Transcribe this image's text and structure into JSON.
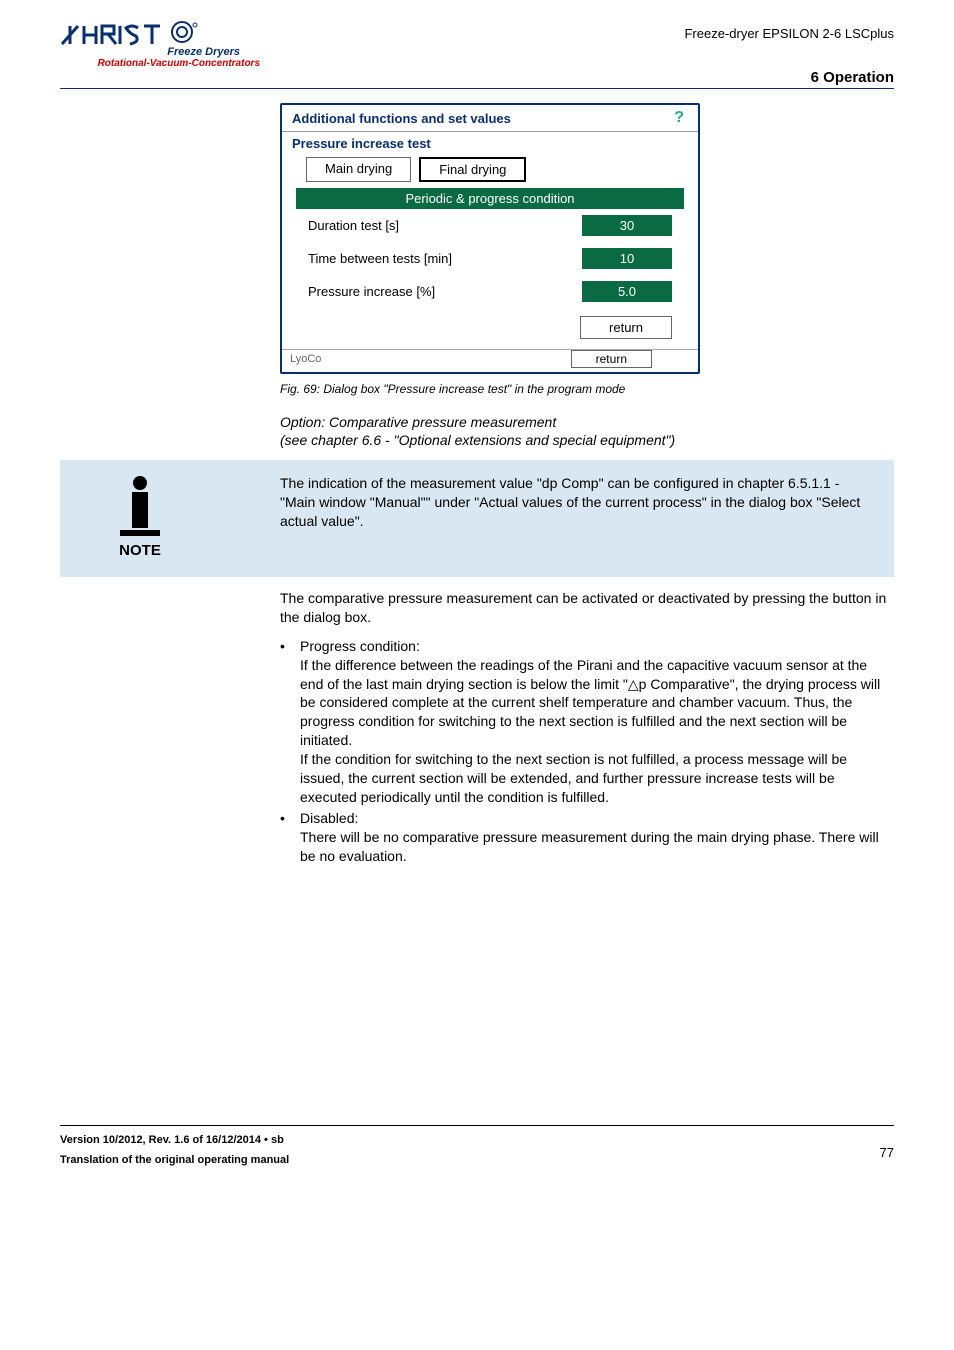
{
  "header": {
    "product": "Freeze-dryer EPSILON 2-6 LSCplus",
    "section": "6 Operation",
    "logo": {
      "tag1": "Freeze Dryers",
      "tag2": "Rotational-Vacuum-Concentrators"
    }
  },
  "dialog": {
    "title": "Additional functions and set values",
    "help": "?",
    "subtitle": "Pressure increase test",
    "tabs": {
      "main": "Main drying",
      "final": "Final drying"
    },
    "band": "Periodic & progress condition",
    "rows": {
      "duration": {
        "label": "Duration test [s]",
        "value": "30"
      },
      "between": {
        "label": "Time between tests [min]",
        "value": "10"
      },
      "increase": {
        "label": "Pressure increase [%]",
        "value": "5.0"
      }
    },
    "return": "return",
    "lyoco": "LyoCo",
    "return2": "return"
  },
  "figcaption": "Fig. 69: Dialog box \"Pressure increase test\" in the program mode",
  "option": {
    "line1": "Option: Comparative pressure measurement",
    "line2": "(see chapter 6.6 - \"Optional extensions and special equipment\")"
  },
  "note": {
    "label": "NOTE",
    "text": "The indication of the measurement value \"dp Comp\" can be configured in chapter 6.5.1.1 - \"Main window \"Manual\"\" under \"Actual values of the current process\" in the dialog box \"Select actual value\"."
  },
  "body": {
    "intro": "The comparative pressure measurement can be activated or deactivated by pressing the button in the dialog box.",
    "b1_title": "Progress condition:",
    "b1_p1": "If the difference between the readings of the Pirani and the capacitive vacuum sensor at the end of the last main drying section is below the limit \"△p Comparative\", the drying process will be considered complete at the current shelf temperature and chamber vacuum. Thus, the progress condition for switching to the next section is fulfilled and the next section will be initiated.",
    "b1_p2": "If the condition for switching to the next section is not fulfilled, a process message will be issued, the current section will be extended, and further pressure increase tests will be executed periodically until the condition is fulfilled.",
    "b2_title": "Disabled:",
    "b2_p1": "There will be no comparative pressure measurement during the main drying phase. There will be no evaluation."
  },
  "footer": {
    "line1": "Version 10/2012, Rev. 1.6 of 16/12/2014 • sb",
    "line2": "Translation of the original operating manual",
    "page": "77"
  }
}
